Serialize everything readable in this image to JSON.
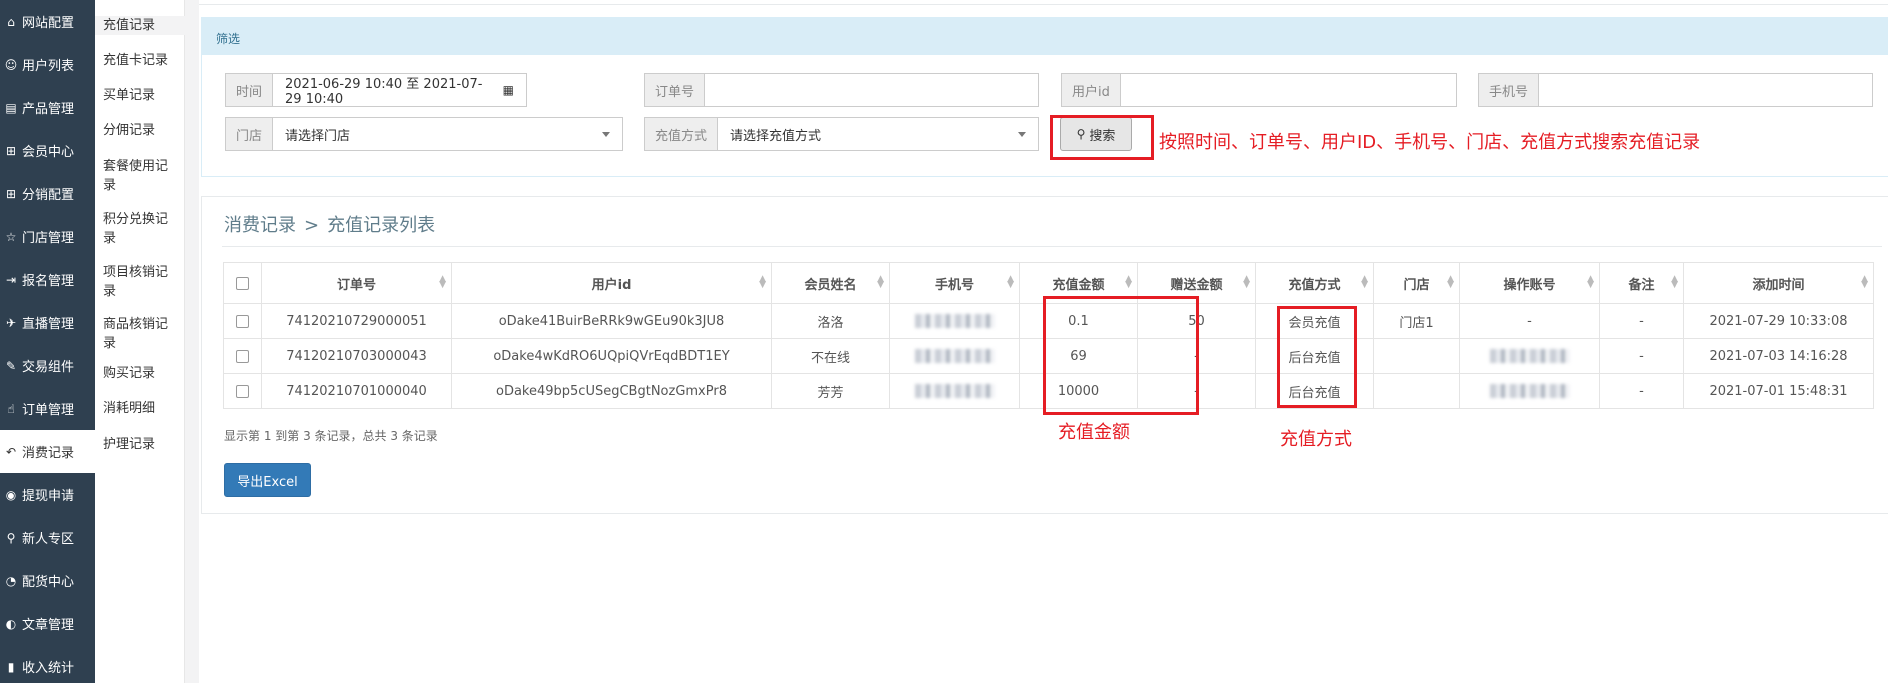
{
  "sidebar": {
    "items": [
      {
        "icon": "home-icon",
        "glyph": "⌂",
        "label": "网站配置"
      },
      {
        "icon": "user-icon",
        "glyph": "☺",
        "label": "用户列表"
      },
      {
        "icon": "hdd-icon",
        "glyph": "▤",
        "label": "产品管理"
      },
      {
        "icon": "cart-icon",
        "glyph": "⊞",
        "label": "会员中心"
      },
      {
        "icon": "cart-icon",
        "glyph": "⊞",
        "label": "分销配置"
      },
      {
        "icon": "star-icon",
        "glyph": "☆",
        "label": "门店管理"
      },
      {
        "icon": "signin-icon",
        "glyph": "⇥",
        "label": "报名管理"
      },
      {
        "icon": "plane-icon",
        "glyph": "✈",
        "label": "直播管理"
      },
      {
        "icon": "eraser-icon",
        "glyph": "✎",
        "label": "交易组件"
      },
      {
        "icon": "thumbs-up-icon",
        "glyph": "☝",
        "label": "订单管理"
      },
      {
        "icon": "reply-icon",
        "glyph": "↶",
        "label": "消费记录"
      },
      {
        "icon": "wechat-icon",
        "glyph": "◉",
        "label": "提现申请"
      },
      {
        "icon": "map-marker-icon",
        "glyph": "⚲",
        "label": "新人专区"
      },
      {
        "icon": "pie-chart-icon",
        "glyph": "◔",
        "label": "配货中心"
      },
      {
        "icon": "adjust-icon",
        "glyph": "◐",
        "label": "文章管理"
      },
      {
        "icon": "bar-chart-icon",
        "glyph": "▮",
        "label": "收入统计"
      }
    ]
  },
  "submenu": {
    "items": [
      "充值记录",
      "充值卡记录",
      "买单记录",
      "分佣记录",
      "套餐使用记录",
      "积分兑换记录",
      "项目核销记录",
      "商品核销记录",
      "购买记录",
      "消耗明细",
      "护理记录"
    ]
  },
  "filter": {
    "title": "筛选",
    "time_label": "时间",
    "time_value": "2021-06-29 10:40 至 2021-07-29 10:40",
    "order_label": "订单号",
    "order_value": "",
    "userid_label": "用户id",
    "userid_value": "",
    "phone_label": "手机号",
    "phone_value": "",
    "store_label": "门店",
    "store_placeholder": "请选择门店",
    "method_label": "充值方式",
    "method_placeholder": "请选择充值方式",
    "search_label": "搜索"
  },
  "annotations": {
    "search_note": "按照时间、订单号、用户ID、手机号、门店、充值方式搜索充值记录",
    "amount_note": "充值金额",
    "method_note": "充值方式",
    "color": "#e51d24"
  },
  "breadcrumb": {
    "parent": "消费记录",
    "separator": ">",
    "current": "充值记录列表"
  },
  "table": {
    "columns": [
      "订单号",
      "用户id",
      "会员姓名",
      "手机号",
      "充值金额",
      "赠送金额",
      "充值方式",
      "门店",
      "操作账号",
      "备注",
      "添加时间"
    ],
    "rows": [
      {
        "order": "74120210729000051",
        "user_id": "oDake41BuirBeRRk9wGEu90k3JU8",
        "name": "洛洛",
        "amount": "0.1",
        "bonus": "50",
        "method": "会员充值",
        "store": "门店1",
        "operator": "-",
        "remark": "-",
        "time": "2021-07-29 10:33:08"
      },
      {
        "order": "74120210703000043",
        "user_id": "oDake4wKdRO6UQpiQVrEqdBDT1EY",
        "name": "不在线",
        "amount": "69",
        "bonus": "-",
        "method": "后台充值",
        "store": "",
        "operator": "",
        "remark": "-",
        "time": "2021-07-03 14:16:28"
      },
      {
        "order": "74120210701000040",
        "user_id": "oDake49bp5cUSegCBgtNozGmxPr8",
        "name": "芳芳",
        "amount": "10000",
        "bonus": "-",
        "method": "后台充值",
        "store": "",
        "operator": "",
        "remark": "-",
        "time": "2021-07-01 15:48:31"
      }
    ]
  },
  "pager": {
    "info": "显示第 1 到第 3 条记录，总共 3 条记录"
  },
  "export_label": "导出Excel"
}
